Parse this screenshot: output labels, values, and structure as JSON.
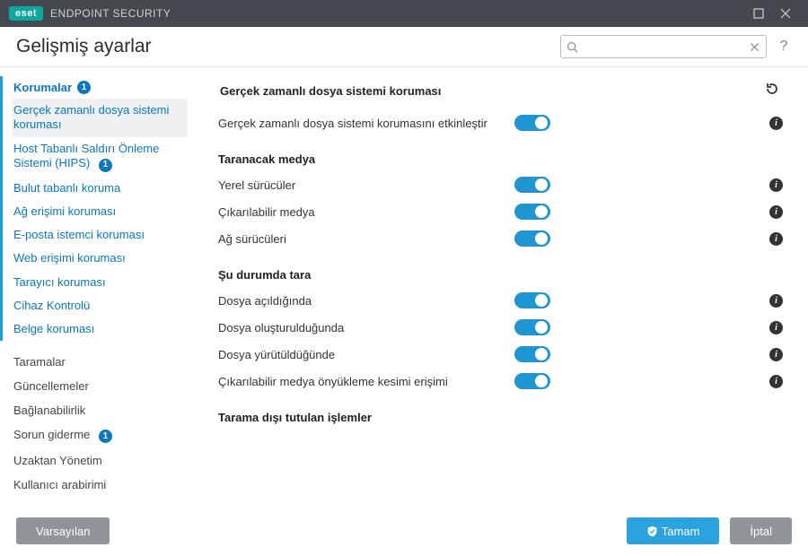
{
  "titlebar": {
    "brand": "eset",
    "product": "ENDPOINT SECURITY"
  },
  "header": {
    "title": "Gelişmiş ayarlar",
    "search_placeholder": ""
  },
  "sidebar": {
    "korumalar": {
      "label": "Korumalar",
      "badge": "1"
    },
    "sub": {
      "realtime": "Gerçek zamanlı dosya sistemi koruması",
      "hips": "Host Tabanlı Saldırı Önleme Sistemi (HIPS)",
      "hips_badge": "1",
      "cloud": "Bulut tabanlı koruma",
      "network": "Ağ erişimi koruması",
      "email": "E-posta istemci koruması",
      "web": "Web erişimi koruması",
      "browser": "Tarayıcı koruması",
      "device": "Cihaz Kontrolü",
      "document": "Belge koruması"
    },
    "taramalar": "Taramalar",
    "updates": "Güncellemeler",
    "connect": "Bağlanabilirlik",
    "troubleshoot": {
      "label": "Sorun giderme",
      "badge": "1"
    },
    "remote": "Uzaktan Yönetim",
    "ui": "Kullanıcı arabirimi"
  },
  "main": {
    "section_title": "Gerçek zamanlı dosya sistemi koruması",
    "enable_label": "Gerçek zamanlı dosya sistemi korumasını etkinleştir",
    "media_heading": "Taranacak medya",
    "local_drives": "Yerel sürücüler",
    "removable": "Çıkarılabilir medya",
    "net_drives": "Ağ sürücüleri",
    "scan_when_heading": "Şu durumda tara",
    "file_open": "Dosya açıldığında",
    "file_create": "Dosya oluşturulduğunda",
    "file_exec": "Dosya yürütüldüğünde",
    "boot_sector": "Çıkarılabilir medya önyükleme kesimi erişimi",
    "excluded_heading": "Tarama dışı tutulan işlemler"
  },
  "footer": {
    "default": "Varsayılan",
    "ok": "Tamam",
    "cancel": "İptal"
  }
}
